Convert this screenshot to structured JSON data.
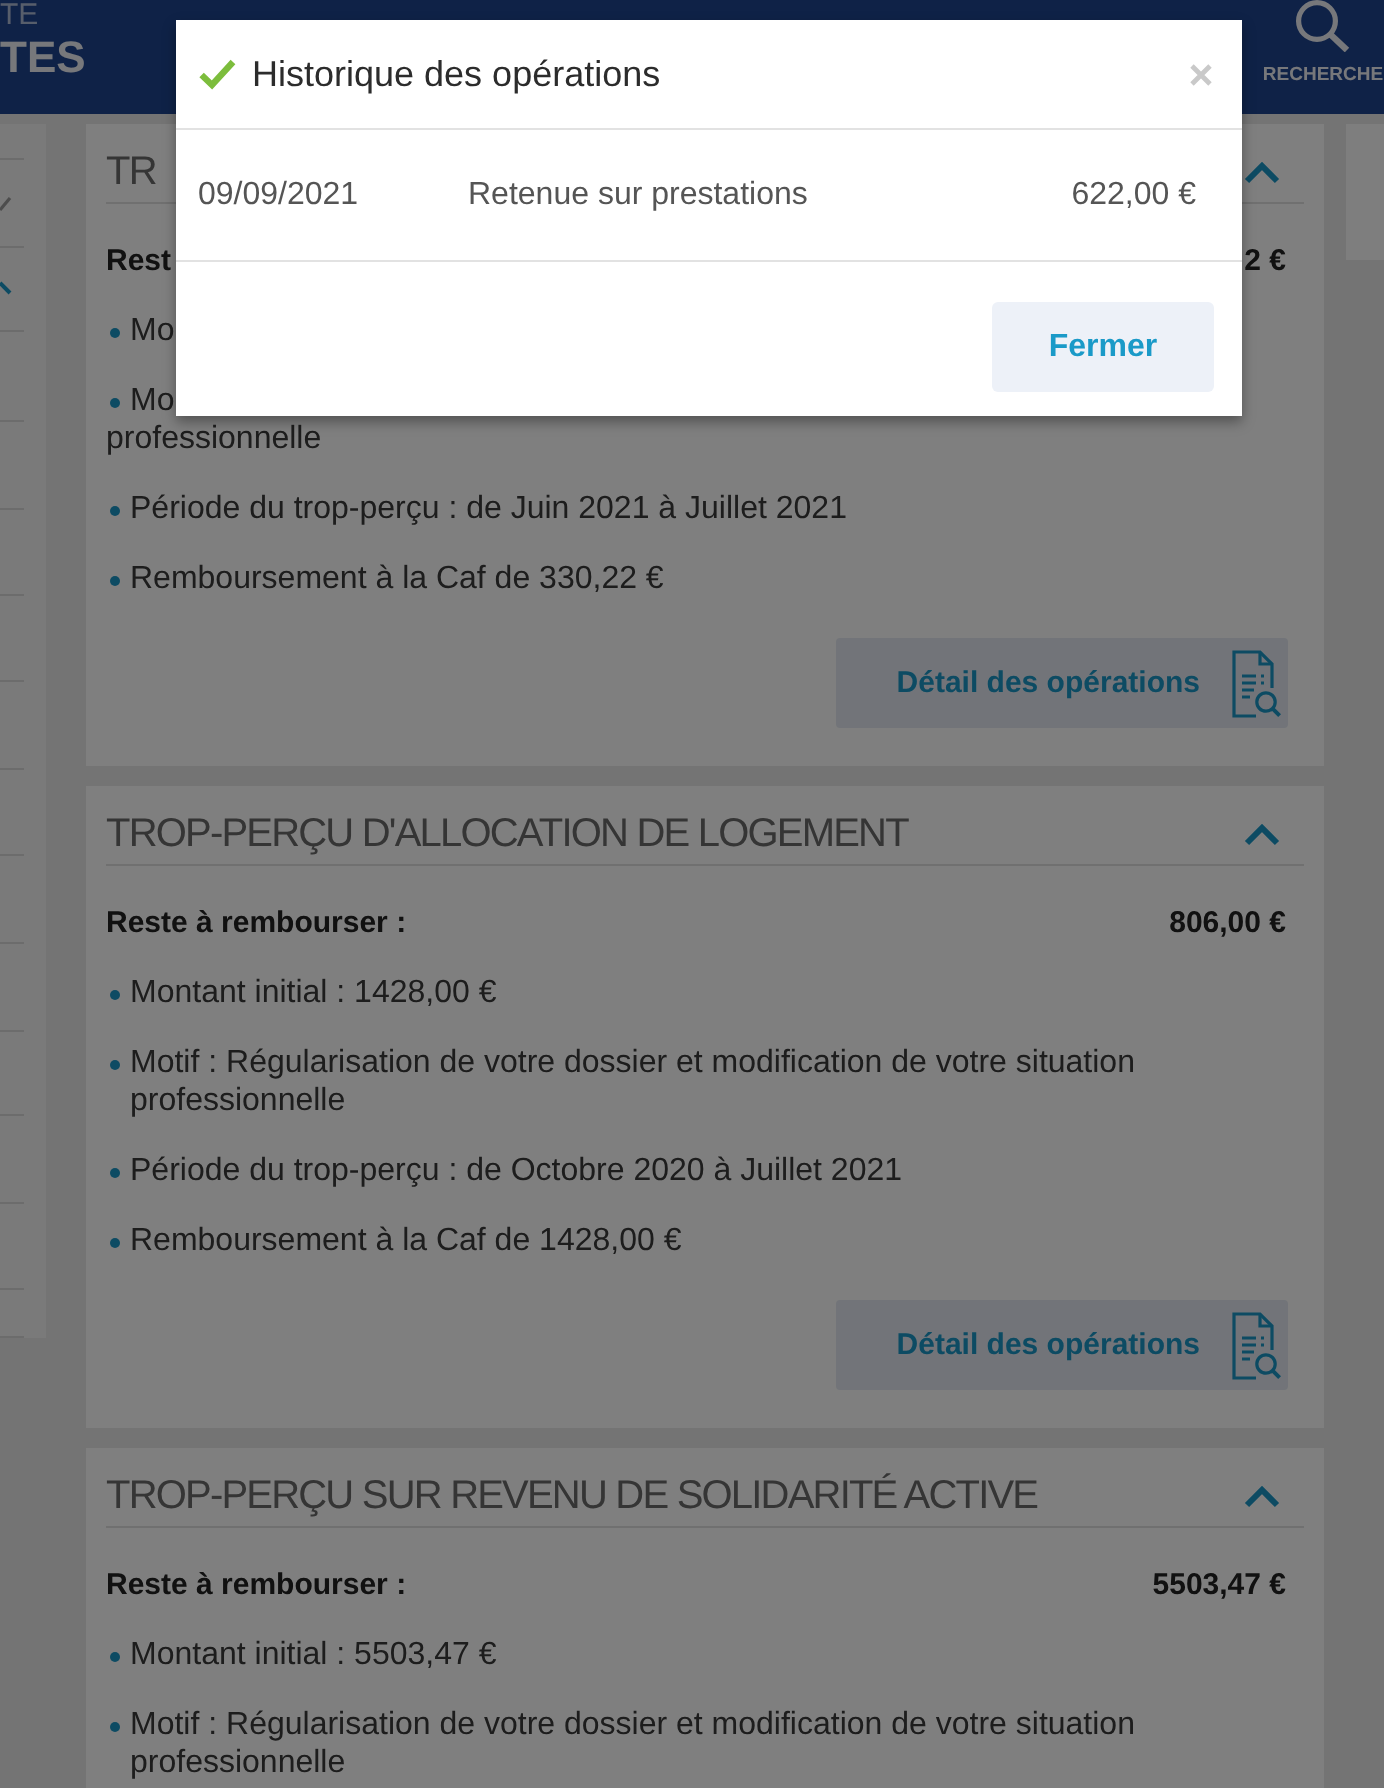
{
  "top_bar": {
    "title_lines": [
      "TE",
      "TES"
    ],
    "search_label": "RECHERCHE"
  },
  "cards": [
    {
      "title": "TR",
      "expanded": true,
      "balance_label": "Rest",
      "balance": "2 €",
      "items": [
        {
          "text": "Mo"
        },
        {
          "text": "Mo",
          "continuation": "professionnelle"
        },
        {
          "text": "Période du trop-perçu : de Juin 2021 à Juillet 2021"
        },
        {
          "text": "Remboursement à la Caf de 330,22 €"
        }
      ],
      "action": "Détail des opérations"
    },
    {
      "title": "TROP-PERÇU D'ALLOCATION DE LOGEMENT",
      "expanded": true,
      "balance_label": "Reste à rembourser :",
      "balance": "806,00 €",
      "items": [
        {
          "text": "Montant initial : 1428,00 €"
        },
        {
          "text": "Motif : Régularisation de votre dossier et modification de votre situation professionnelle"
        },
        {
          "text": "Période du trop-perçu : de Octobre 2020 à Juillet 2021"
        },
        {
          "text": "Remboursement à la Caf de 1428,00 €"
        }
      ],
      "action": "Détail des opérations"
    },
    {
      "title": "TROP-PERÇU SUR REVENU DE SOLIDARITÉ ACTIVE",
      "expanded": true,
      "balance_label": "Reste à rembourser :",
      "balance": "5503,47 €",
      "items": [
        {
          "text": "Montant initial : 5503,47 €"
        },
        {
          "text": "Motif : Régularisation de votre dossier et modification de votre situation professionnelle"
        }
      ]
    }
  ],
  "dialog": {
    "title": "Historique des opérations",
    "rows": [
      {
        "date": "09/09/2021",
        "label": "Retenue sur prestations",
        "amount": "622,00 €"
      }
    ],
    "buttons": [
      {
        "label": "Fermer"
      }
    ]
  }
}
